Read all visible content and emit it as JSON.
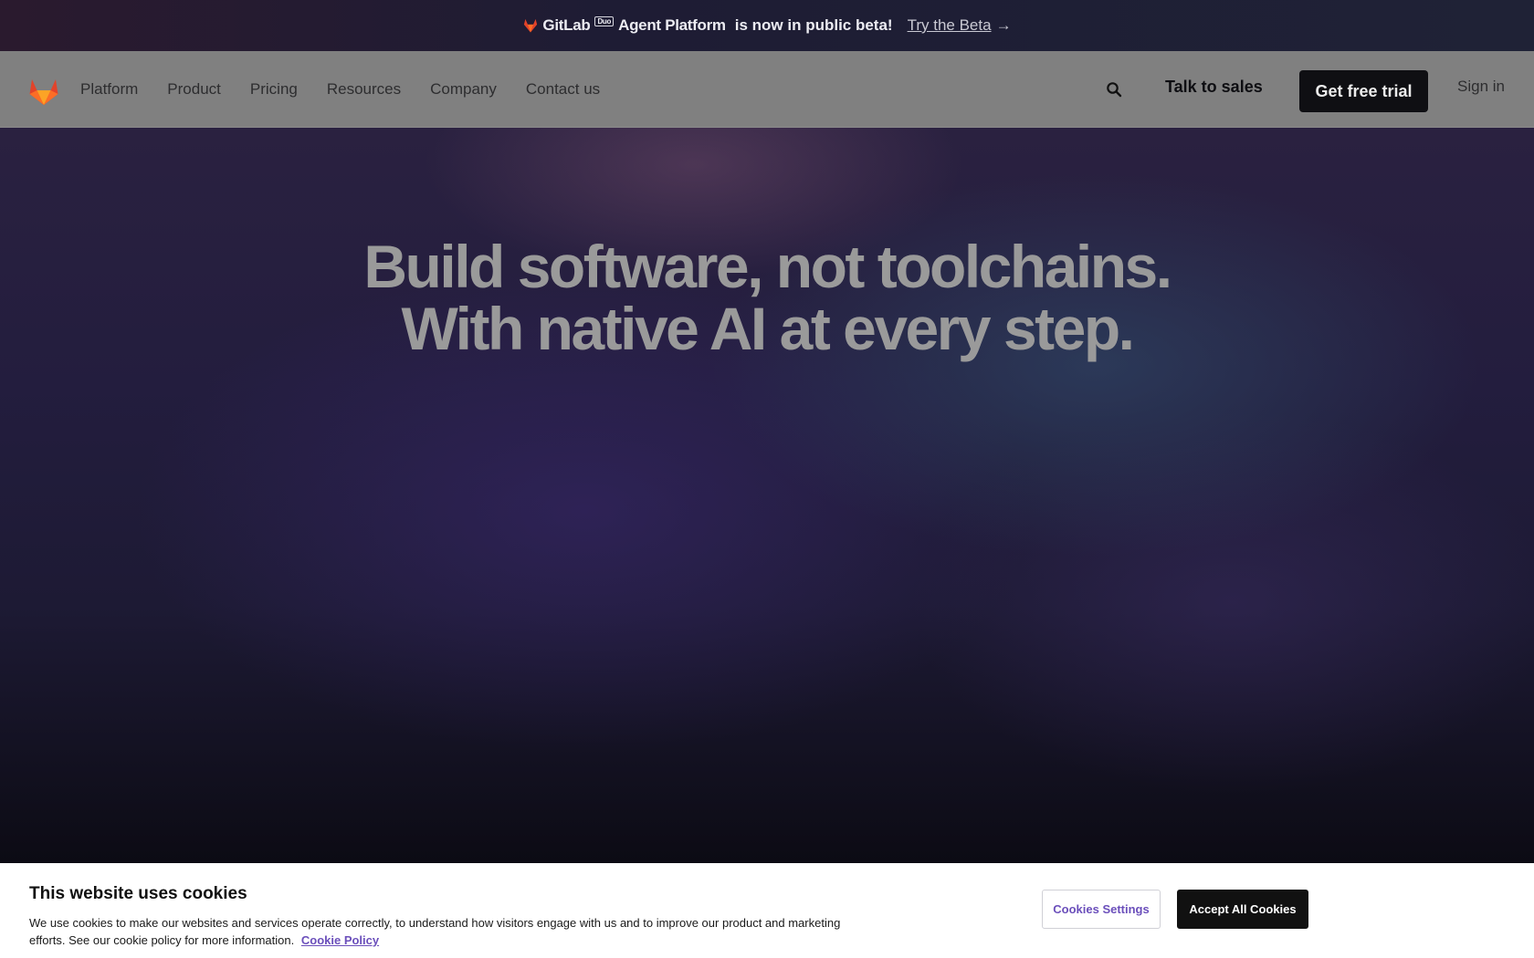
{
  "announcement": {
    "brand_name": "GitLab",
    "brand_badge": "Duo",
    "brand_product": "Agent Platform",
    "message": "is now in public beta!",
    "cta": "Try the Beta",
    "cta_arrow": "→"
  },
  "nav": {
    "items": [
      {
        "label": "Platform"
      },
      {
        "label": "Product"
      },
      {
        "label": "Pricing"
      },
      {
        "label": "Resources"
      },
      {
        "label": "Company"
      },
      {
        "label": "Contact us"
      }
    ],
    "talk_to_sales": "Talk to sales",
    "free_trial": "Get free trial",
    "sign_in": "Sign in"
  },
  "hero": {
    "line1": "Build software, not toolchains.",
    "line2": "With native AI at every step."
  },
  "cookie": {
    "title": "This website uses cookies",
    "description": "We use cookies to make our websites and services operate correctly, to understand how visitors engage with us and to improve our product and marketing efforts. See our cookie policy for more information.",
    "policy_link": "Cookie Policy",
    "settings_button": "Cookies Settings",
    "accept_button": "Accept All Cookies"
  },
  "colors": {
    "accent_orange": "#e2432a",
    "link_purple": "#6b4fbb",
    "nav_bg": "#808080"
  },
  "icons": {
    "logo": "gitlab-tanuki-icon",
    "search": "search-icon"
  }
}
